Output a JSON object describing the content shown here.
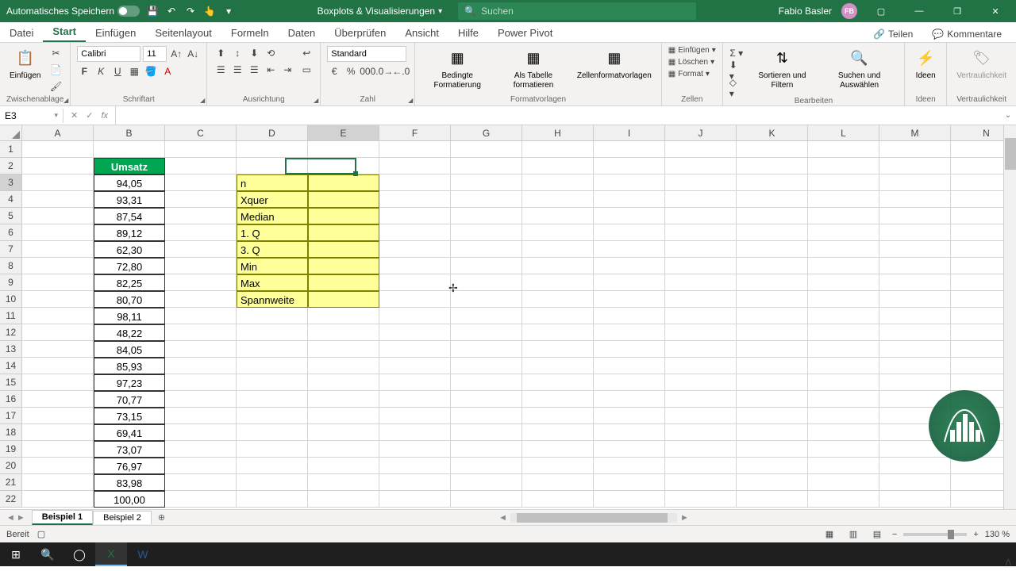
{
  "title_bar": {
    "autosave": "Automatisches Speichern",
    "doc_name": "Boxplots & Visualisierungen",
    "search_placeholder": "Suchen",
    "user_name": "Fabio Basler",
    "user_initials": "FB"
  },
  "ribbon_tabs": [
    "Datei",
    "Start",
    "Einfügen",
    "Seitenlayout",
    "Formeln",
    "Daten",
    "Überprüfen",
    "Ansicht",
    "Hilfe",
    "Power Pivot"
  ],
  "ribbon_tabs_active": 1,
  "share": "Teilen",
  "comments": "Kommentare",
  "ribbon": {
    "clipboard": {
      "label": "Zwischenablage",
      "paste": "Einfügen"
    },
    "font": {
      "label": "Schriftart",
      "name": "Calibri",
      "size": "11"
    },
    "alignment": {
      "label": "Ausrichtung"
    },
    "number": {
      "label": "Zahl",
      "format": "Standard"
    },
    "styles": {
      "label": "Formatvorlagen",
      "cond": "Bedingte Formatierung",
      "table": "Als Tabelle formatieren",
      "cell": "Zellenformatvorlagen"
    },
    "cells": {
      "label": "Zellen",
      "insert": "Einfügen",
      "delete": "Löschen",
      "format": "Format"
    },
    "editing": {
      "label": "Bearbeiten",
      "sort": "Sortieren und Filtern",
      "find": "Suchen und Auswählen"
    },
    "ideas": {
      "label": "Ideen",
      "btn": "Ideen"
    },
    "sensitivity": {
      "label": "Vertraulichkeit",
      "btn": "Vertraulichkeit"
    }
  },
  "name_box": "E3",
  "formula": "",
  "columns": [
    "A",
    "B",
    "C",
    "D",
    "E",
    "F",
    "G",
    "H",
    "I",
    "J",
    "K",
    "L",
    "M",
    "N"
  ],
  "rows": [
    1,
    2,
    3,
    4,
    5,
    6,
    7,
    8,
    9,
    10,
    11,
    12,
    13,
    14,
    15,
    16,
    17,
    18,
    19,
    20,
    21,
    22
  ],
  "active_col": 4,
  "active_row": 2,
  "data": {
    "header": "Umsatz",
    "values": [
      "94,05",
      "93,31",
      "87,54",
      "89,12",
      "62,30",
      "72,80",
      "82,25",
      "80,70",
      "98,11",
      "48,22",
      "84,05",
      "85,93",
      "97,23",
      "70,77",
      "73,15",
      "69,41",
      "73,07",
      "76,97",
      "83,98",
      "100,00"
    ],
    "stats": [
      "n",
      "Xquer",
      "Median",
      "1. Q",
      "3. Q",
      "Min",
      "Max",
      "Spannweite"
    ]
  },
  "sheets": [
    "Beispiel 1",
    "Beispiel 2"
  ],
  "active_sheet": 0,
  "status": {
    "ready": "Bereit",
    "zoom": "130 %"
  }
}
